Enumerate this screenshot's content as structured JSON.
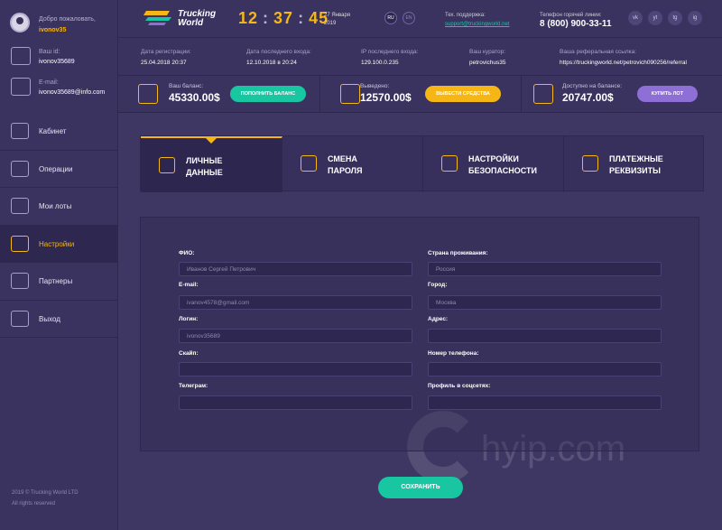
{
  "sidebar": {
    "welcome": "Добро пожаловать,",
    "username": "ivonov35",
    "id_label": "Ваш id:",
    "id_value": "ivonov35689",
    "email_label": "E-mail:",
    "email_value": "ivonov35689@info.com",
    "items": [
      {
        "label": "Кабинет",
        "icon": "cabinet-icon"
      },
      {
        "label": "Операции",
        "icon": "operations-icon"
      },
      {
        "label": "Мои лоты",
        "icon": "lots-icon"
      },
      {
        "label": "Настройки",
        "icon": "settings-icon"
      },
      {
        "label": "Партнеры",
        "icon": "partners-icon"
      },
      {
        "label": "Выход",
        "icon": "logout-icon"
      }
    ],
    "active_index": 3,
    "copyright": "2019 © Trucking World LTD",
    "rights": "All rights reserved"
  },
  "header": {
    "logo_line1": "Trucking",
    "logo_line2": "World",
    "clock_h": "12",
    "clock_m": "37",
    "clock_s": "45",
    "date_line1": "27 Января",
    "date_line2": "2019",
    "lang_ru": "RU",
    "lang_en": "EN",
    "support_label": "Тех. поддержка:",
    "support_email": "support@truckingworld.net",
    "hotline_label": "Телефон горячей линии:",
    "hotline_number": "8 (800) 900-33-11",
    "social": [
      "vk",
      "yt",
      "tg",
      "ig"
    ]
  },
  "info": {
    "reg_label": "Дата регистрации:",
    "reg_value": "25.04.2018  20:37",
    "last_label": "Дата последнего входа:",
    "last_value": "12.10.2018 в 20:24",
    "ip_label": "IP последнего входа:",
    "ip_value": "129.100.0.235",
    "curator_label": "Ваш куратор:",
    "curator_value": "petrovichus35",
    "ref_label": "Ваша реферальная ссылка:",
    "ref_value": "https://truckingworld.net/petrovich090256/referral"
  },
  "balance": {
    "bal_label": "Ваш баланс:",
    "bal_value": "45330.00$",
    "bal_btn": "ПОПОЛНИТЬ БАЛАНС",
    "out_label": "Выведено:",
    "out_value": "12570.00$",
    "out_btn": "ВЫВЕСТИ СРЕДСТВА",
    "avail_label": "Доступно на балансе:",
    "avail_value": "20747.00$",
    "avail_btn": "КУПИТЬ ЛОТ"
  },
  "tabs": [
    {
      "line1": "Личные",
      "line2": "данные"
    },
    {
      "line1": "Смена",
      "line2": "пароля"
    },
    {
      "line1": "Настройки",
      "line2": "безопасности"
    },
    {
      "line1": "Платежные",
      "line2": "реквизиты"
    }
  ],
  "form": {
    "fio_label": "ФИО:",
    "fio_value": "Иванов Сергей Петрович",
    "email_label": "E-mail:",
    "email_value": "ivanov4578@gmail.com",
    "login_label": "Логин:",
    "login_value": "ivonov35689",
    "skype_label": "Скайп:",
    "skype_value": "",
    "telegram_label": "Телеграм:",
    "telegram_value": "",
    "country_label": "Страна проживания:",
    "country_value": "Россия",
    "city_label": "Город:",
    "city_value": "Москва",
    "address_label": "Адрес:",
    "address_value": "",
    "phone_label": "Номер телефона:",
    "phone_value": "",
    "social_label": "Профиль в соцсетях:",
    "social_value": "",
    "save": "СОХРАНИТЬ"
  },
  "watermark": "hyip.com",
  "colors": {
    "accent": "#f6b616",
    "green": "#18c6a2",
    "purple": "#8d6fd6",
    "bg": "#3c3560"
  }
}
